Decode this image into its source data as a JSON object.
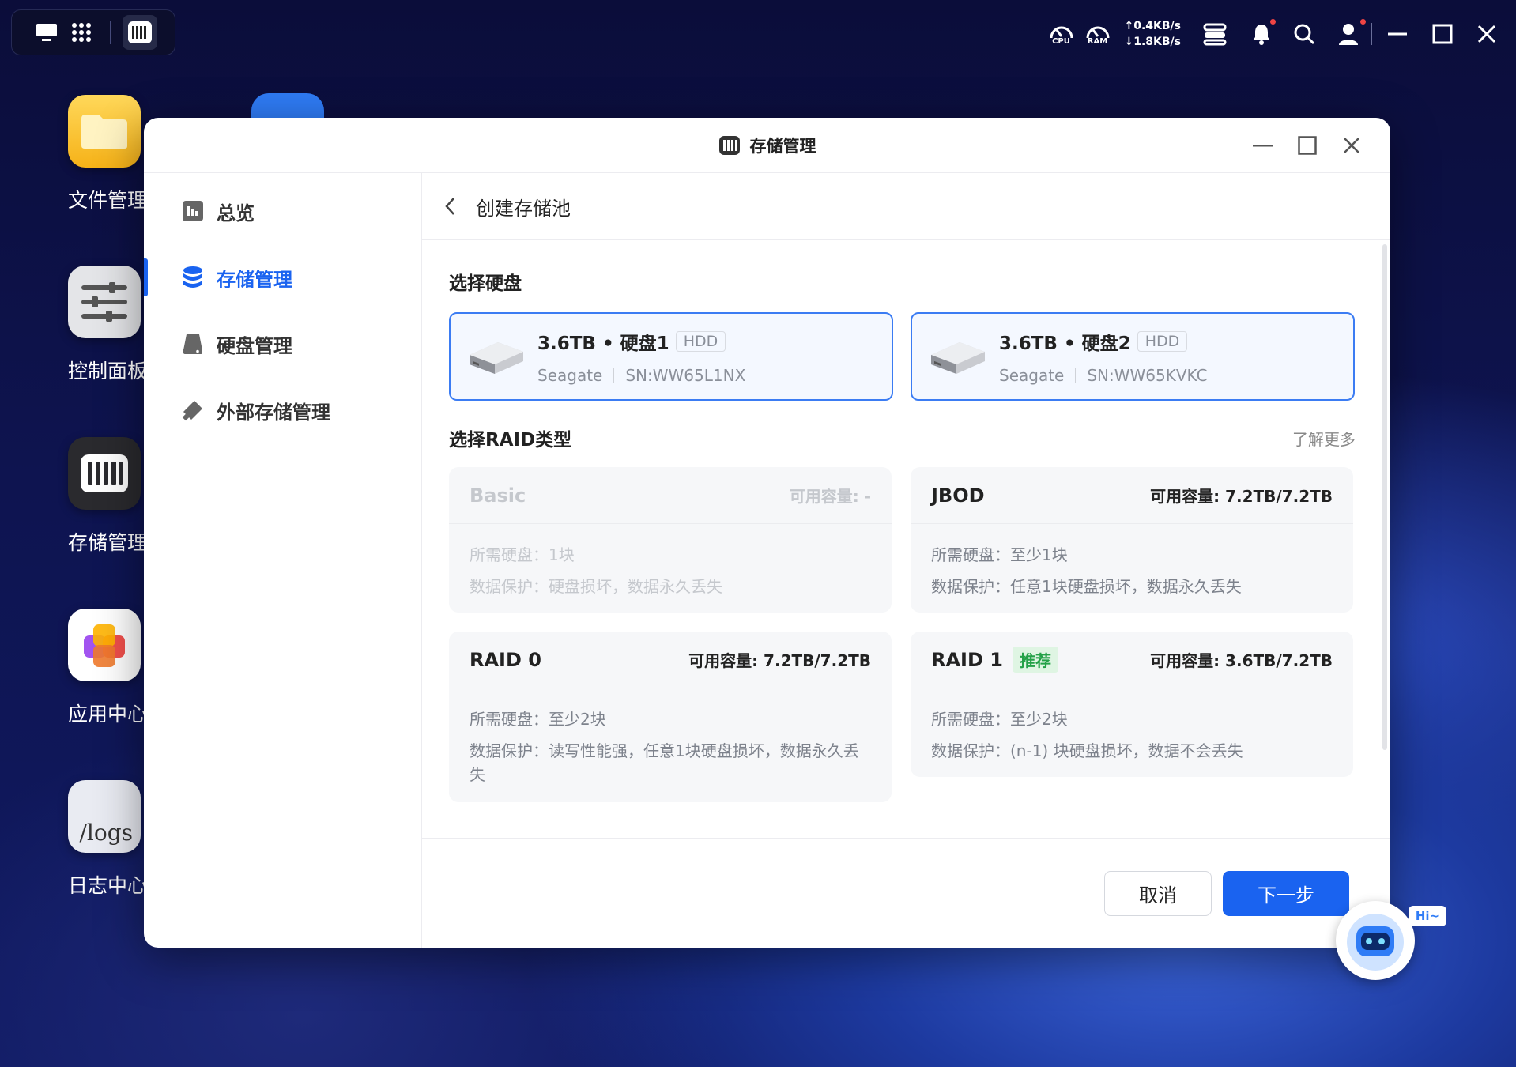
{
  "taskbar": {
    "monitor": {
      "cpu_label": "CPU",
      "ram_label": "RAM",
      "upload": "↑0.4KB/s",
      "download": "↓1.8KB/s"
    }
  },
  "desktop": {
    "icons": [
      {
        "label": "文件管理"
      },
      {
        "label": "控制面板"
      },
      {
        "label": "存储管理"
      },
      {
        "label": "应用中心"
      },
      {
        "label": "日志中心",
        "tile_text": "/logs"
      }
    ]
  },
  "window": {
    "title": "存储管理"
  },
  "sidebar": {
    "items": [
      {
        "label": "总览"
      },
      {
        "label": "存储管理"
      },
      {
        "label": "硬盘管理"
      },
      {
        "label": "外部存储管理"
      }
    ]
  },
  "breadcrumb": "创建存储池",
  "disk_section": {
    "title": "选择硬盘",
    "disks": [
      {
        "size": "3.6TB • 硬盘1",
        "type": "HDD",
        "brand": "Seagate",
        "sn": "SN:WW65L1NX"
      },
      {
        "size": "3.6TB • 硬盘2",
        "type": "HDD",
        "brand": "Seagate",
        "sn": "SN:WW65KVKC"
      }
    ]
  },
  "raid_section": {
    "title": "选择RAID类型",
    "more": "了解更多",
    "options": [
      {
        "name": "Basic",
        "cap": "可用容量: -",
        "req": "所需硬盘：1块",
        "prot": "数据保护：硬盘损坏，数据永久丢失"
      },
      {
        "name": "JBOD",
        "cap": "可用容量: 7.2TB/7.2TB",
        "req": "所需硬盘：至少1块",
        "prot": "数据保护：任意1块硬盘损坏，数据永久丢失"
      },
      {
        "name": "RAID 0",
        "cap": "可用容量: 7.2TB/7.2TB",
        "req": "所需硬盘：至少2块",
        "prot": "数据保护：读写性能强，任意1块硬盘损坏，数据永久丢失"
      },
      {
        "name": "RAID 1",
        "badge": "推荐",
        "cap": "可用容量: 3.6TB/7.2TB",
        "req": "所需硬盘：至少2块",
        "prot": "数据保护：(n-1) 块硬盘损坏，数据不会丢失"
      }
    ]
  },
  "footer": {
    "cancel": "取消",
    "next": "下一步"
  },
  "assistant": {
    "bubble": "Hi~"
  },
  "colors": {
    "accent": "#1a63f0",
    "recommend": "#24a148"
  }
}
